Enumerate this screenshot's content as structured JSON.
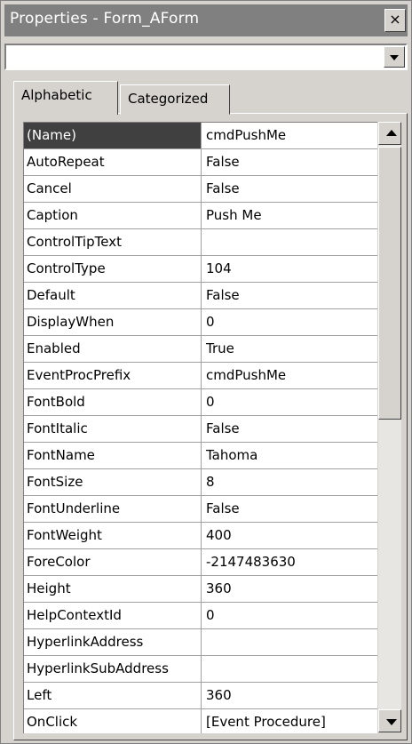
{
  "window": {
    "title": "Properties - Form_AForm",
    "close_glyph": "×"
  },
  "object_selector": {
    "value": ""
  },
  "tabs": [
    {
      "label": "Alphabetic",
      "active": true
    },
    {
      "label": "Categorized",
      "active": false
    }
  ],
  "properties": [
    {
      "name": "(Name)",
      "value": "cmdPushMe",
      "selected": true
    },
    {
      "name": "AutoRepeat",
      "value": "False"
    },
    {
      "name": "Cancel",
      "value": "False"
    },
    {
      "name": "Caption",
      "value": "Push Me"
    },
    {
      "name": "ControlTipText",
      "value": ""
    },
    {
      "name": "ControlType",
      "value": "104"
    },
    {
      "name": "Default",
      "value": "False"
    },
    {
      "name": "DisplayWhen",
      "value": "0"
    },
    {
      "name": "Enabled",
      "value": "True"
    },
    {
      "name": "EventProcPrefix",
      "value": "cmdPushMe"
    },
    {
      "name": "FontBold",
      "value": "0"
    },
    {
      "name": "FontItalic",
      "value": "False"
    },
    {
      "name": "FontName",
      "value": "Tahoma"
    },
    {
      "name": "FontSize",
      "value": "8"
    },
    {
      "name": "FontUnderline",
      "value": "False"
    },
    {
      "name": "FontWeight",
      "value": "400"
    },
    {
      "name": "ForeColor",
      "value": "-2147483630"
    },
    {
      "name": "Height",
      "value": "360"
    },
    {
      "name": "HelpContextId",
      "value": "0"
    },
    {
      "name": "HyperlinkAddress",
      "value": ""
    },
    {
      "name": "HyperlinkSubAddress",
      "value": ""
    },
    {
      "name": "Left",
      "value": "360"
    },
    {
      "name": "OnClick",
      "value": "[Event Procedure]"
    }
  ],
  "scrollbar": {
    "position_fraction": 0.0
  },
  "colors": {
    "title_bar": "#808080",
    "face": "#d6d3ce",
    "selected_row": "#404040"
  }
}
